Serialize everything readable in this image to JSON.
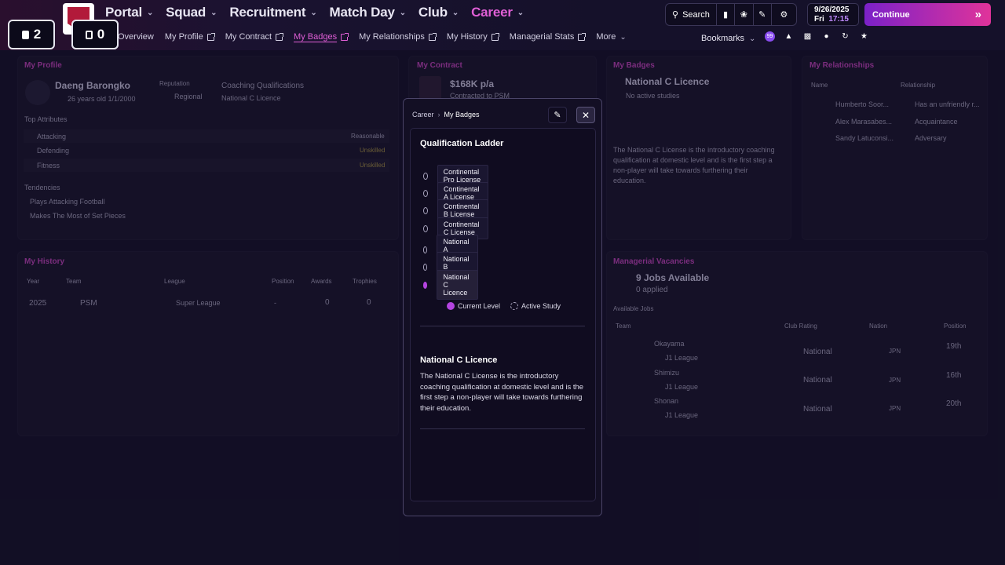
{
  "colors": {
    "accent": "#e05fd6",
    "continue_start": "#7b21c8",
    "continue_end": "#e0339a",
    "current_level": "#b444e0"
  },
  "counters": [
    {
      "value": "2"
    },
    {
      "value": "0"
    }
  ],
  "main_nav": [
    {
      "label": "Portal"
    },
    {
      "label": "Squad"
    },
    {
      "label": "Recruitment"
    },
    {
      "label": "Match Day"
    },
    {
      "label": "Club"
    },
    {
      "label": "Career"
    }
  ],
  "sub_nav": {
    "overview": "Overview",
    "profile": "My Profile",
    "contract": "My Contract",
    "badges": "My Badges",
    "relationships": "My Relationships",
    "history": "My History",
    "stats": "Managerial Stats",
    "more": "More"
  },
  "toolbar": {
    "search_label": "Search"
  },
  "date": {
    "day": "9/26/2025",
    "weekday": "Fri",
    "time": "17:15"
  },
  "continue_label": "Continue",
  "bookmarks_label": "Bookmarks",
  "notification_badge": "99",
  "profile": {
    "title": "My Profile",
    "name": "Daeng Barongko",
    "age": "26 years old 1/1/2000",
    "reputation_label": "Reputation",
    "reputation": "Regional",
    "coaching_label": "Coaching Qualifications",
    "coaching": "National C Licence",
    "attributes_label": "Top Attributes",
    "attributes": [
      {
        "name": "Attacking",
        "value": "Reasonable"
      },
      {
        "name": "Defending",
        "value": "Unskilled"
      },
      {
        "name": "Fitness",
        "value": "Unskilled"
      }
    ],
    "tendencies_label": "Tendencies",
    "tendencies": [
      "Plays Attacking Football",
      "Makes The Most of Set Pieces"
    ]
  },
  "contract": {
    "title": "My Contract",
    "salary": "$168K p/a",
    "club": "Contracted to PSM"
  },
  "badges_panel": {
    "title": "My Badges",
    "licence": "National C Licence",
    "studies": "No active studies",
    "description": "The National C License is the introductory coaching qualification at domestic level and is the first step a non-player will take towards furthering their education."
  },
  "relationships": {
    "title": "My Relationships",
    "col_name": "Name",
    "col_relationship": "Relationship",
    "rows": [
      {
        "name": "Humberto Soor...",
        "relation": "Has an unfriendly r..."
      },
      {
        "name": "Alex Marasabes...",
        "relation": "Acquaintance"
      },
      {
        "name": "Sandy Latuconsi...",
        "relation": "Adversary"
      }
    ]
  },
  "history": {
    "title": "My History",
    "headers": [
      "Year",
      "Team",
      "League",
      "Position",
      "Awards",
      "Trophies"
    ],
    "rows": [
      {
        "year": "2025",
        "team": "PSM",
        "league": "Super League",
        "position": "-",
        "awards": "0",
        "trophies": "0"
      }
    ]
  },
  "vacancies": {
    "title": "Managerial Vacancies",
    "count": "9 Jobs Available",
    "applied": "0 applied",
    "list_label": "Available Jobs",
    "headers": [
      "Team",
      "Club Rating",
      "Nation",
      "Position"
    ],
    "rows": [
      {
        "team": "Okayama",
        "league": "J1 League",
        "rating": "National",
        "nation": "JPN",
        "position": "19th"
      },
      {
        "team": "Shimizu",
        "league": "J1 League",
        "rating": "National",
        "nation": "JPN",
        "position": "16th"
      },
      {
        "team": "Shonan",
        "league": "J1 League",
        "rating": "National",
        "nation": "JPN",
        "position": "20th"
      }
    ]
  },
  "modal": {
    "breadcrumb_root": "Career",
    "breadcrumb_current": "My Badges",
    "title": "Qualification Ladder",
    "ladder": [
      {
        "label": "Continental Pro License",
        "current": false
      },
      {
        "label": "Continental A License",
        "current": false
      },
      {
        "label": "Continental B License",
        "current": false
      },
      {
        "label": "Continental C License",
        "current": false
      },
      {
        "label": "National A License",
        "current": false
      },
      {
        "label": "National B License",
        "current": false
      },
      {
        "label": "National C Licence",
        "current": true
      }
    ],
    "legend_current": "Current Level",
    "legend_active": "Active Study",
    "detail_title": "National C Licence",
    "detail_text": "The National C License is the introductory coaching qualification at domestic level and is the first step a non-player will take towards furthering their education."
  }
}
